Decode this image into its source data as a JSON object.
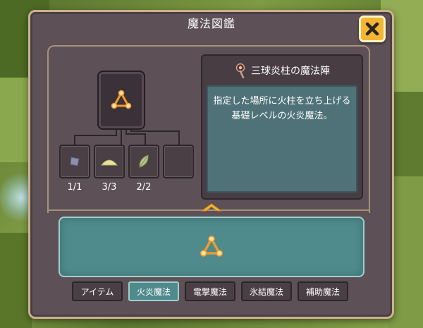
{
  "window": {
    "title": "魔法図鑑",
    "close_label": "×"
  },
  "skill_tree": {
    "main_icon": "triangle-circle-icon",
    "materials": [
      {
        "icon": "crystal-icon",
        "count": "1/1"
      },
      {
        "icon": "powder-pile-icon",
        "count": "3/3"
      },
      {
        "icon": "leaf-icon",
        "count": "2/2"
      },
      {
        "icon": "",
        "count": ""
      }
    ]
  },
  "description": {
    "icon": "magic-staff-icon",
    "name": "三球炎柱の魔法陣",
    "text_line1": "指定した場所に火柱を立ち上げる",
    "text_line2": "基礎レベルの火炎魔法。"
  },
  "selected_spell": {
    "icon": "triangle-circle-icon"
  },
  "tabs": [
    {
      "label": "アイテム",
      "active": false
    },
    {
      "label": "火炎魔法",
      "active": true
    },
    {
      "label": "電撃魔法",
      "active": false
    },
    {
      "label": "氷結魔法",
      "active": false
    },
    {
      "label": "補助魔法",
      "active": false
    }
  ],
  "colors": {
    "panel": "#5d5057",
    "accent_teal": "#4f8a8c",
    "close_button": "#f2b632",
    "frame_gold": "#cbb28e",
    "spell_orange": "#f39b2a"
  }
}
